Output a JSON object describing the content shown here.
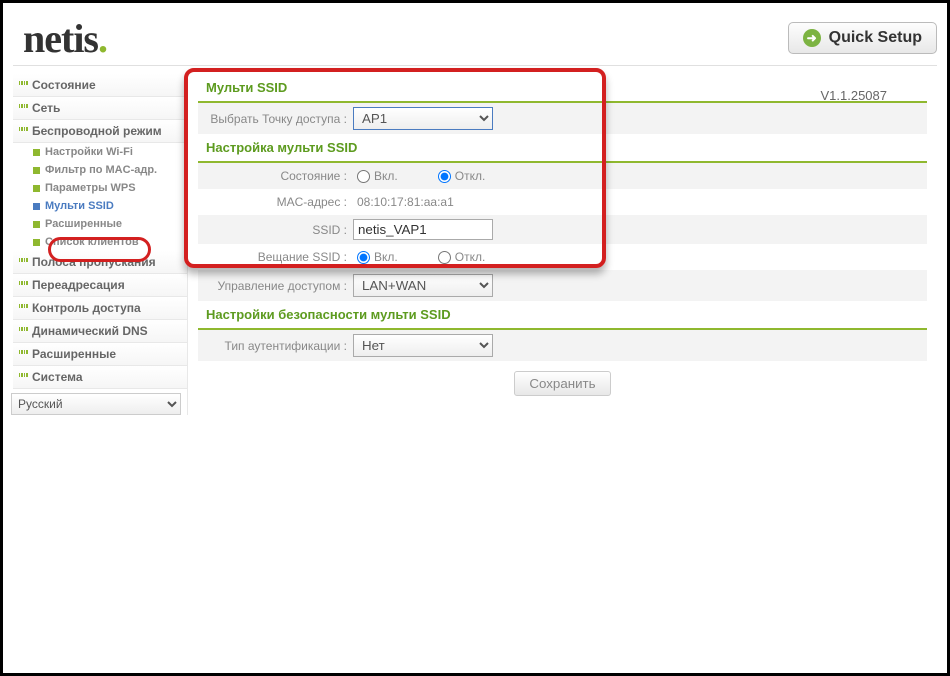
{
  "header": {
    "logo_text": "netis",
    "quick_setup_label": "Quick Setup"
  },
  "version": "V1.1.25087",
  "sidebar": {
    "status": "Состояние",
    "network": "Сеть",
    "wireless": "Беспроводной режим",
    "wifi_settings": "Настройки Wi-Fi",
    "mac_filter": "Фильтр по MAC-адр.",
    "wps": "Параметры WPS",
    "multi_ssid": "Мульти SSID",
    "advanced_sub": "Расширенные",
    "client_list": "Список клиентов",
    "bandwidth": "Полоса пропускания",
    "forwarding": "Переадресация",
    "access_control": "Контроль доступа",
    "ddns": "Динамический DNS",
    "advanced": "Расширенные",
    "system": "Система",
    "language": "Русский"
  },
  "main": {
    "section1_title": "Мульти SSID",
    "ap_label": "Выбрать Точку доступа :",
    "ap_value": "AP1",
    "section2_title": "Настройка мульти SSID",
    "state_label": "Состояние :",
    "on_label": "Вкл.",
    "off_label": "Откл.",
    "mac_label": "MAC-адрес :",
    "mac_value": "08:10:17:81:aa:a1",
    "ssid_label": "SSID :",
    "ssid_value": "netis_VAP1",
    "broadcast_label": "Вещание SSID :",
    "access_label": "Управление доступом :",
    "access_value": "LAN+WAN",
    "section3_title": "Настройки безопасности мульти SSID",
    "auth_label": "Тип аутентификации :",
    "auth_value": "Нет",
    "save_label": "Сохранить"
  }
}
